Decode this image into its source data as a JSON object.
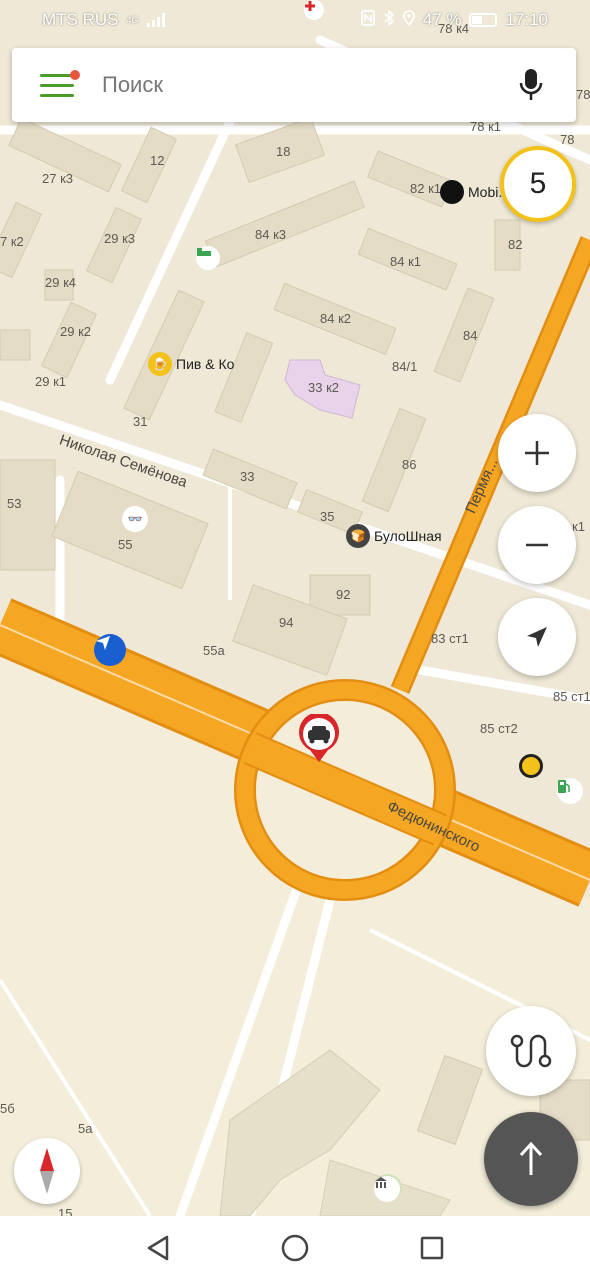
{
  "status_bar": {
    "carrier": "MTS RUS",
    "network": "4G",
    "battery": "47 %",
    "battery_level": 0.47,
    "time": "17:10"
  },
  "search": {
    "placeholder": "Поиск"
  },
  "traffic_level": "5",
  "map": {
    "streets": {
      "nikolaya": "Николая Семёнова",
      "fedyuninskogo": "Федюнинского",
      "permyakova": "Пермя..."
    },
    "buildings": [
      "78 к4",
      "78 к1",
      "78",
      "78",
      "12",
      "18",
      "27 к3",
      "82 к1",
      "7 к2",
      "29 к3",
      "84 к3",
      "82",
      "29 к4",
      "84 к1",
      "29 к2",
      "84 к2",
      "84",
      "29 к1",
      "84/1",
      "33 к2",
      "31",
      "86",
      "33",
      "53",
      "35",
      "55",
      "к1",
      "92",
      "94",
      "55а",
      "83 ст1",
      "85 ст1",
      "85 ст2",
      "5б",
      "5а",
      "15"
    ],
    "pois": {
      "beer": "Пив & Ко",
      "bakery": "БулоШная",
      "mobile": "Mobi..."
    }
  },
  "colors": {
    "map_bg": "#efe8d6",
    "road_major": "#f5a623",
    "accent_green": "#4c9a2a",
    "traffic_yellow": "#f2c21a"
  }
}
